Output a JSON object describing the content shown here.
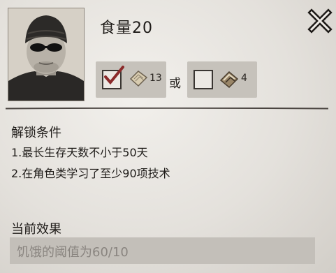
{
  "title": "食量20",
  "close_icon": "close-x-icon",
  "costs": [
    {
      "checked": true,
      "icon": "paper-scraps-icon",
      "quantity": "13"
    },
    {
      "checked": false,
      "icon": "book-bundle-icon",
      "quantity": "4"
    }
  ],
  "or_label": "或",
  "unlock": {
    "title": "解锁条件",
    "conditions": [
      "1.最长生存天数不小于50天",
      "2.在角色类学习了至少90项技术"
    ]
  },
  "effect": {
    "title": "当前效果",
    "text": "饥饿的阈值为60/10"
  },
  "colors": {
    "accent_check": "#8b2a2a",
    "panel_bg": "#e8e5e0",
    "cost_bg": "#c6c2bb"
  }
}
